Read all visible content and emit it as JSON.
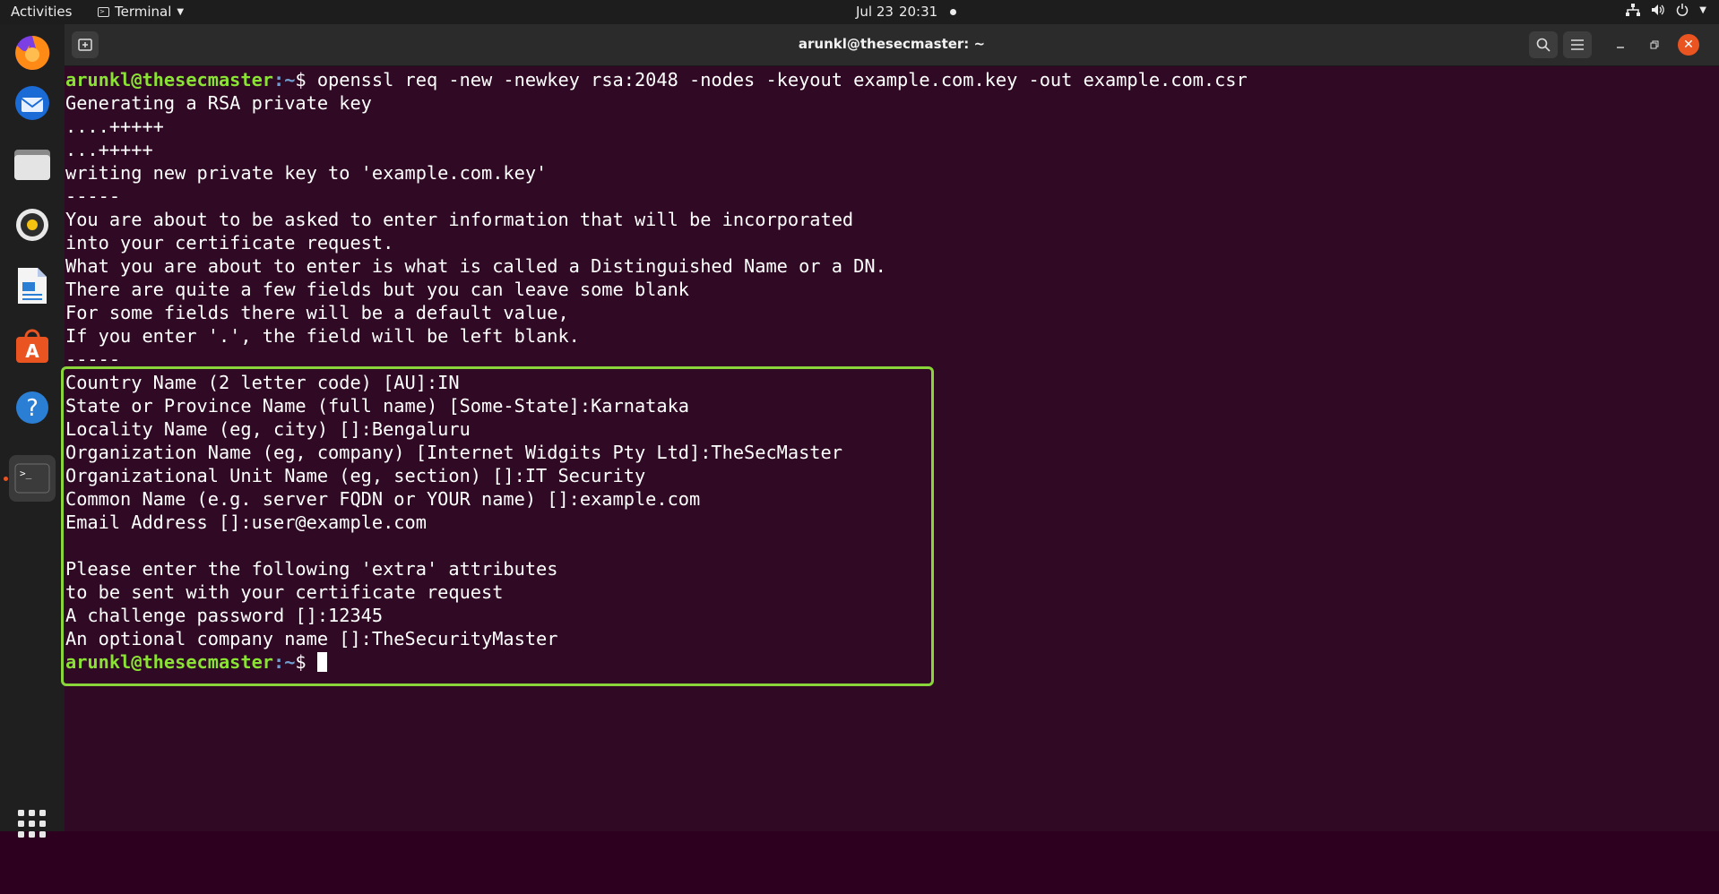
{
  "topbar": {
    "activities": "Activities",
    "app_name": "Terminal",
    "date": "Jul 23",
    "time": "20:31"
  },
  "dock": {
    "items": [
      "firefox",
      "thunderbird",
      "files",
      "rhythmbox",
      "libreoffice-writer",
      "ubuntu-software",
      "help",
      "terminal"
    ],
    "active": "terminal"
  },
  "window": {
    "title": "arunkl@thesecmaster: ~"
  },
  "terminal": {
    "prompt_user": "arunkl@thesecmaster",
    "prompt_path": ":~",
    "prompt_symbol": "$ ",
    "command": "openssl req -new -newkey rsa:2048 -nodes -keyout example.com.key -out example.com.csr",
    "output": [
      "Generating a RSA private key",
      "....+++++",
      "...+++++",
      "writing new private key to 'example.com.key'",
      "-----",
      "You are about to be asked to enter information that will be incorporated",
      "into your certificate request.",
      "What you are about to enter is what is called a Distinguished Name or a DN.",
      "There are quite a few fields but you can leave some blank",
      "For some fields there will be a default value,",
      "If you enter '.', the field will be left blank.",
      "-----",
      "Country Name (2 letter code) [AU]:IN",
      "State or Province Name (full name) [Some-State]:Karnataka",
      "Locality Name (eg, city) []:Bengaluru",
      "Organization Name (eg, company) [Internet Widgits Pty Ltd]:TheSecMaster",
      "Organizational Unit Name (eg, section) []:IT Security",
      "Common Name (e.g. server FQDN or YOUR name) []:example.com",
      "Email Address []:user@example.com",
      "",
      "Please enter the following 'extra' attributes",
      "to be sent with your certificate request",
      "A challenge password []:12345",
      "An optional company name []:TheSecurityMaster"
    ]
  },
  "colors": {
    "terminal_bg": "#300a24",
    "prompt_user": "#8ae234",
    "prompt_path": "#729fcf",
    "highlight": "#8ad63a",
    "close_button": "#e95420"
  }
}
